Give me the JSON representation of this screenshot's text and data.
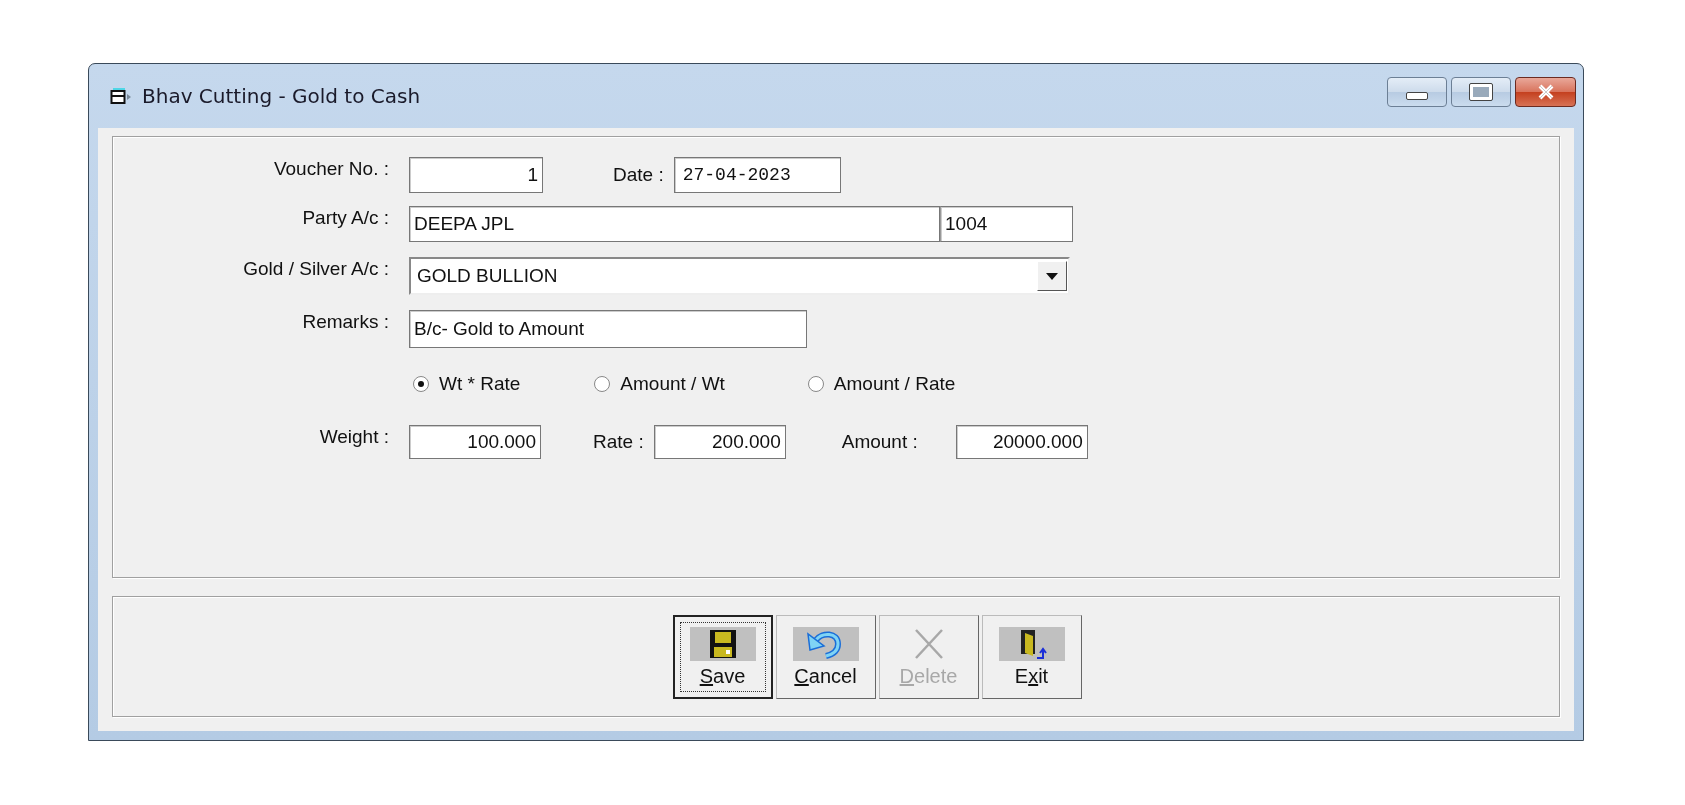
{
  "window": {
    "title": "Bhav Cutting - Gold to Cash"
  },
  "form": {
    "voucher_no": {
      "label": "Voucher No. :",
      "value": "1"
    },
    "date": {
      "label": "Date  :",
      "value": "27-04-2023"
    },
    "party": {
      "label": "Party A/c  :",
      "value": "DEEPA JPL",
      "code": "1004"
    },
    "metal_account": {
      "label": "Gold / Silver A/c  :",
      "value": "GOLD BULLION"
    },
    "remarks": {
      "label": "Remarks  :",
      "value": "B/c- Gold to Amount"
    },
    "calc_modes": [
      {
        "label": "Wt * Rate",
        "selected": true
      },
      {
        "label": "Amount / Wt",
        "selected": false
      },
      {
        "label": "Amount / Rate",
        "selected": false
      }
    ],
    "weight": {
      "label": "Weight  :",
      "value": "100.000"
    },
    "rate": {
      "label": "Rate  :",
      "value": "200.000"
    },
    "amount": {
      "label": "Amount  :",
      "value": "20000.000"
    }
  },
  "buttons": [
    {
      "kind": "save",
      "key": "S",
      "after": "ave",
      "disabled": false,
      "focused": true
    },
    {
      "kind": "cancel",
      "key": "C",
      "after": "ancel",
      "disabled": false,
      "focused": false
    },
    {
      "kind": "delete",
      "key": "D",
      "after": "elete",
      "disabled": true,
      "focused": false
    },
    {
      "kind": "exit",
      "before": "E",
      "key": "x",
      "after": "it",
      "disabled": false,
      "focused": false
    }
  ]
}
